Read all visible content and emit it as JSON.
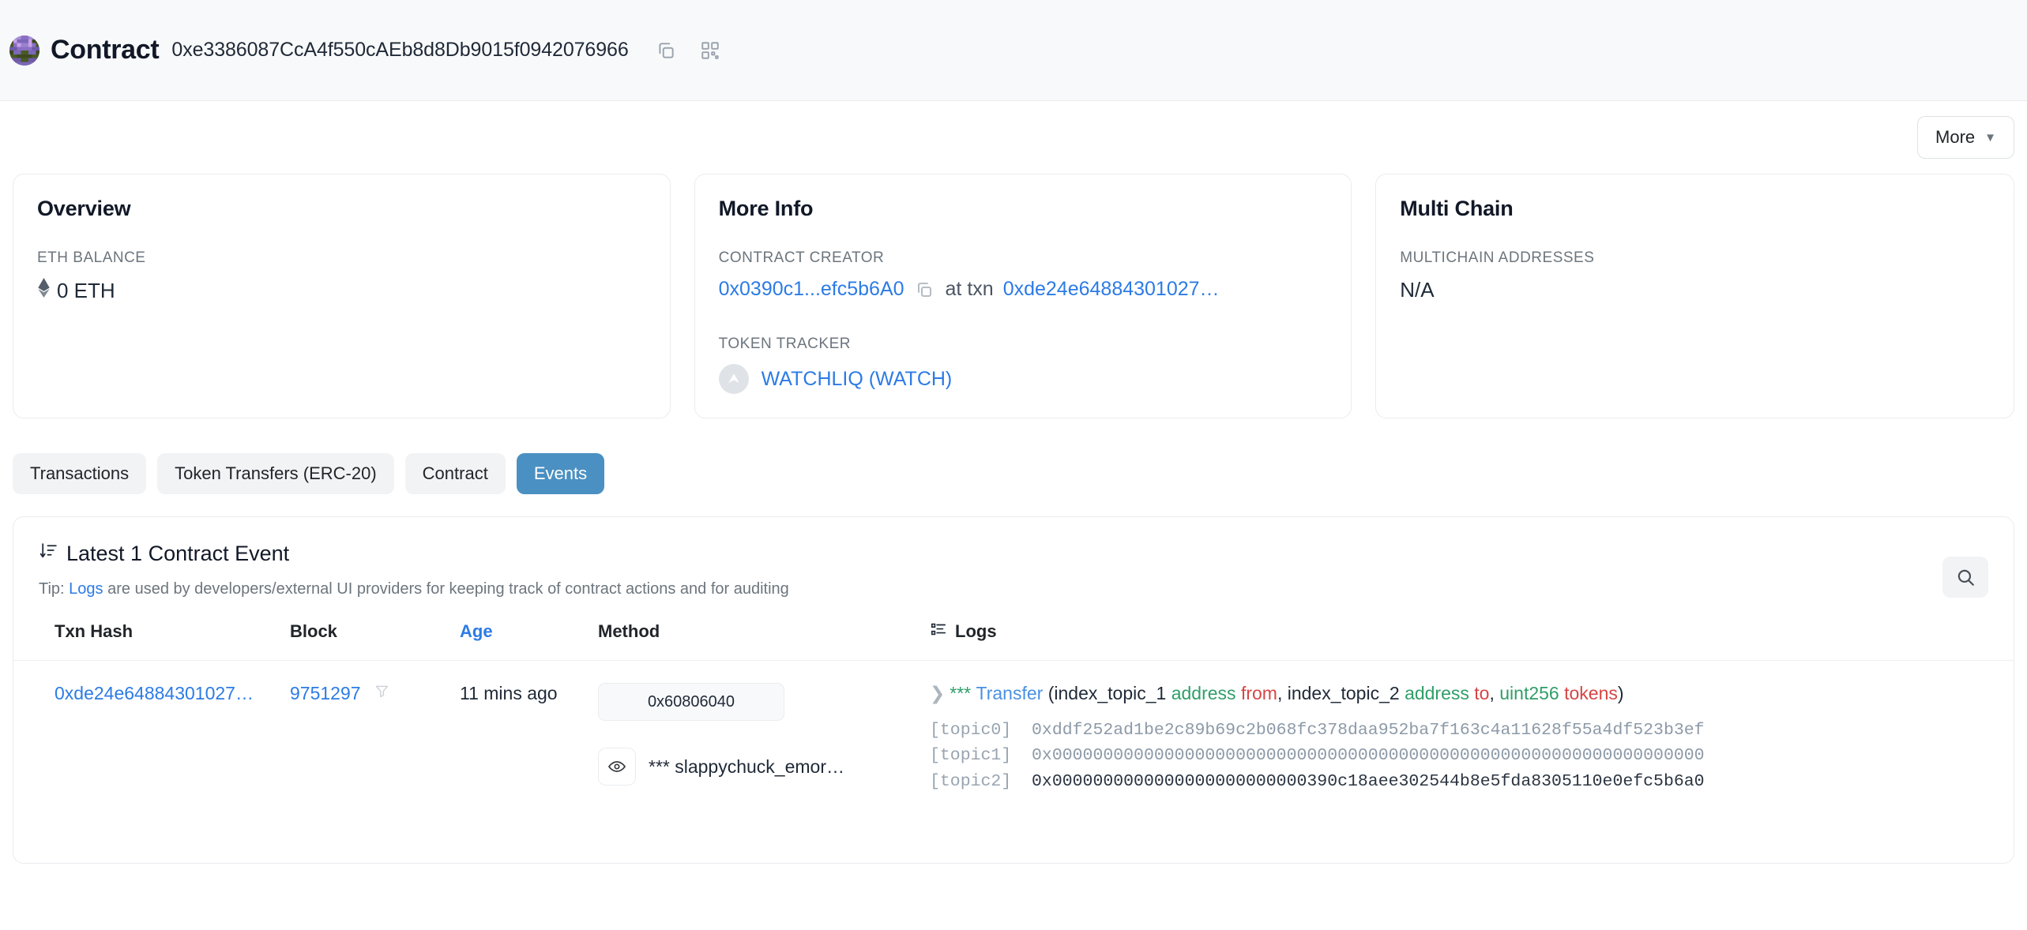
{
  "header": {
    "title": "Contract",
    "address": "0xe3386087CcA4f550cAEb8d8Db9015f0942076966",
    "copy_icon": "copy-icon",
    "qr_icon": "qr-code-icon"
  },
  "toolbar": {
    "more_label": "More",
    "chevron": "chevron-down-icon"
  },
  "overview": {
    "title": "Overview",
    "balance_label": "ETH BALANCE",
    "balance_value": "0 ETH",
    "eth_glyph": "ethereum-diamond-icon"
  },
  "more_info": {
    "title": "More Info",
    "creator_label": "CONTRACT CREATOR",
    "creator_address": "0x0390c1...efc5b6A0",
    "creator_copy_icon": "copy-icon",
    "at_txn_label": "at txn",
    "creation_txn": "0xde24e64884301027…",
    "token_tracker_label": "TOKEN TRACKER",
    "token_name": "WATCHLIQ (WATCH)",
    "token_icon": "token-logo-icon"
  },
  "multi_chain": {
    "title": "Multi Chain",
    "addresses_label": "MULTICHAIN ADDRESSES",
    "addresses_value": "N/A"
  },
  "tabs": [
    {
      "label": "Transactions",
      "active": false
    },
    {
      "label": "Token Transfers (ERC-20)",
      "active": false
    },
    {
      "label": "Contract",
      "active": false
    },
    {
      "label": "Events",
      "active": true
    }
  ],
  "events_panel": {
    "sort_icon": "sort-descending-icon",
    "heading": "Latest 1 Contract Event",
    "tip_prefix": "Tip:",
    "tip_link": "Logs",
    "tip_suffix": "are used by developers/external UI providers for keeping track of contract actions and for auditing",
    "search_icon": "search-icon",
    "columns": {
      "txn_hash": "Txn Hash",
      "block": "Block",
      "age": "Age",
      "method": "Method",
      "logs": "Logs",
      "logs_icon": "logs-list-icon"
    },
    "rows": [
      {
        "txn_hash": "0xde24e64884301027…",
        "block": "9751297",
        "block_filter_icon": "funnel-filter-icon",
        "age": "11 mins ago",
        "method": "0x60806040",
        "contract_eye_icon": "eye-icon",
        "contract_name": "*** slappychuck_emor…",
        "log": {
          "caret_icon": "chevron-right-icon",
          "stars": "***",
          "event_name": "Transfer",
          "open_paren": "(",
          "params": [
            {
              "index": "index_topic_1",
              "type": "address",
              "name": "from",
              "sep": ", "
            },
            {
              "index": "index_topic_2",
              "type": "address",
              "name": "to",
              "sep": ", "
            },
            {
              "index": "",
              "type": "uint256",
              "name": "tokens",
              "sep": ""
            }
          ],
          "close_paren": ")",
          "topics": [
            {
              "label": "[topic0]",
              "value": "0xddf252ad1be2c89b69c2b068fc378daa952ba7f163c4a11628f55a4df523b3ef",
              "dark": false
            },
            {
              "label": "[topic1]",
              "value": "0x0000000000000000000000000000000000000000000000000000000000000000",
              "dark": false
            },
            {
              "label": "[topic2]",
              "value": "0x0000000000000000000000000390c18aee302544b8e5fda8305110e0efc5b6a0",
              "dark": true
            }
          ]
        }
      }
    ]
  },
  "colors": {
    "link": "#2c7be5",
    "active_tab": "#4a90c2",
    "param_type": "#2f9e68",
    "param_name": "#d64545",
    "event_name": "#4a90e2"
  }
}
